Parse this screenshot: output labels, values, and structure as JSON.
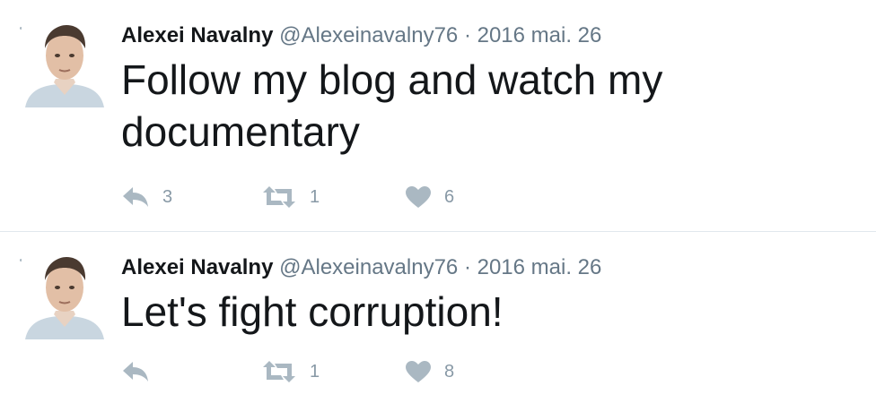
{
  "tweets": [
    {
      "author_name": "Alexei Navalny",
      "handle": "@Alexeinavalny76",
      "separator": "·",
      "date": "2016 mai. 26",
      "text": "Follow my blog and watch my documentary",
      "reply_count": "3",
      "retweet_count": "1",
      "like_count": "6"
    },
    {
      "author_name": "Alexei Navalny",
      "handle": "@Alexeinavalny76",
      "separator": "·",
      "date": "2016 mai. 26",
      "text": "Let's fight corruption!",
      "reply_count": "",
      "retweet_count": "1",
      "like_count": "8"
    }
  ],
  "colors": {
    "text": "#14171a",
    "secondary": "#657786",
    "icon": "#aab8c2",
    "divider": "#e1e8ed"
  },
  "icons": [
    "reply-icon",
    "retweet-icon",
    "heart-icon"
  ]
}
